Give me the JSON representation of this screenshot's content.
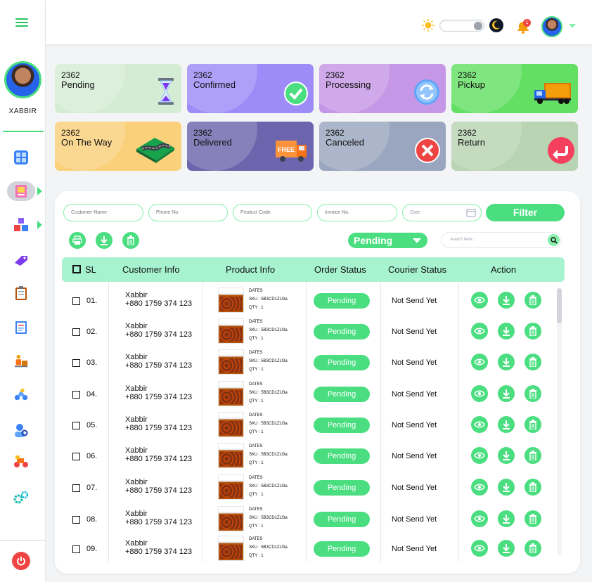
{
  "user": {
    "name": "XABBIR"
  },
  "header": {
    "notification_count": "1"
  },
  "cards": [
    {
      "count": "2362",
      "label": "Pending",
      "color": "#d5ecd4",
      "icon": "hourglass-icon"
    },
    {
      "count": "2362",
      "label": "Confirmed",
      "color": "#9d8cf7",
      "icon": "check-circle-icon"
    },
    {
      "count": "2362",
      "label": "Processing",
      "color": "#c597e6",
      "icon": "refresh-icon"
    },
    {
      "count": "2362",
      "label": "Pickup",
      "color": "#63e063",
      "icon": "truck-icon"
    },
    {
      "count": "2362",
      "label": "On The Way",
      "color": "#fbd07a",
      "icon": "road-icon"
    },
    {
      "count": "2362",
      "label": "Delivered",
      "color": "#6c64ac",
      "icon": "delivery-van-icon"
    },
    {
      "count": "2362",
      "label": "Canceled",
      "color": "#9aa6bf",
      "icon": "cancel-icon"
    },
    {
      "count": "2362",
      "label": "Return",
      "color": "#b8d4b2",
      "icon": "return-icon"
    }
  ],
  "filters": {
    "customer_name_placeholder": "Customer Name",
    "phone_placeholder": "Phone No.",
    "product_code_placeholder": "Product Code",
    "invoice_placeholder": "Invoice No.",
    "date_placeholder": "Date",
    "filter_label": "Filter"
  },
  "toolbar": {
    "status_selected": "Pending",
    "search_placeholder": "search here..."
  },
  "table": {
    "headers": {
      "sl": "SL",
      "customer": "Customer Info",
      "product": "Product Info",
      "order_status": "Order Status",
      "courier_status": "Courier Status",
      "action": "Action"
    },
    "rows": [
      {
        "sl": "01.",
        "name": "Xabbir",
        "phone": "+880 1759 374 123",
        "product": "DATES",
        "sku": "SKU : 5B3CD1ZU3a",
        "qty": "QTY : 1",
        "order_status": "Pending",
        "courier_status": "Not Send Yet"
      },
      {
        "sl": "02.",
        "name": "Xabbir",
        "phone": "+880 1759 374 123",
        "product": "DATES",
        "sku": "SKU : 5B3CD1ZU3a",
        "qty": "QTY : 1",
        "order_status": "Pending",
        "courier_status": "Not Send Yet"
      },
      {
        "sl": "03.",
        "name": "Xabbir",
        "phone": "+880 1759 374 123",
        "product": "DATES",
        "sku": "SKU : 5B3CD1ZU3a",
        "qty": "QTY : 1",
        "order_status": "Pending",
        "courier_status": "Not Send Yet"
      },
      {
        "sl": "04.",
        "name": "Xabbir",
        "phone": "+880 1759 374 123",
        "product": "DATES",
        "sku": "SKU : 5B3CD1ZU3a",
        "qty": "QTY : 1",
        "order_status": "Pending",
        "courier_status": "Not Send Yet"
      },
      {
        "sl": "05.",
        "name": "Xabbir",
        "phone": "+880 1759 374 123",
        "product": "DATES",
        "sku": "SKU : 5B3CD1ZU3a",
        "qty": "QTY : 1",
        "order_status": "Pending",
        "courier_status": "Not Send Yet"
      },
      {
        "sl": "06.",
        "name": "Xabbir",
        "phone": "+880 1759 374 123",
        "product": "DATES",
        "sku": "SKU : 5B3CD1ZU3a",
        "qty": "QTY : 1",
        "order_status": "Pending",
        "courier_status": "Not Send Yet"
      },
      {
        "sl": "07.",
        "name": "Xabbir",
        "phone": "+880 1759 374 123",
        "product": "DATES",
        "sku": "SKU : 5B3CD1ZU3a",
        "qty": "QTY : 1",
        "order_status": "Pending",
        "courier_status": "Not Send Yet"
      },
      {
        "sl": "08.",
        "name": "Xabbir",
        "phone": "+880 1759 374 123",
        "product": "DATES",
        "sku": "SKU : 5B3CD1ZU3a",
        "qty": "QTY : 1",
        "order_status": "Pending",
        "courier_status": "Not Send Yet"
      },
      {
        "sl": "09.",
        "name": "Xabbir",
        "phone": "+880 1759 374 123",
        "product": "DATES",
        "sku": "SKU : 5B3CD1ZU3a",
        "qty": "QTY : 1",
        "order_status": "Pending",
        "courier_status": "Not Send Yet"
      }
    ]
  }
}
